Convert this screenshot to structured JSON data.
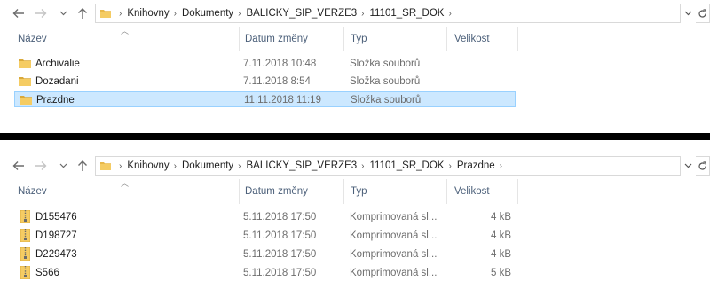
{
  "top": {
    "breadcrumb": [
      "Knihovny",
      "Dokumenty",
      "BALICKY_SIP_VERZE3",
      "11101_SR_DOK"
    ],
    "columns": {
      "name": "Název",
      "date": "Datum změny",
      "type": "Typ",
      "size": "Velikost"
    },
    "rows": [
      {
        "name": "Archivalie",
        "date": "7.11.2018 10:48",
        "type": "Složka souborů",
        "size": ""
      },
      {
        "name": "Dozadani",
        "date": "7.11.2018 8:54",
        "type": "Složka souborů",
        "size": ""
      },
      {
        "name": "Prazdne",
        "date": "11.11.2018 11:19",
        "type": "Složka souborů",
        "size": ""
      }
    ],
    "selected_row": "Prazdne"
  },
  "bottom": {
    "breadcrumb": [
      "Knihovny",
      "Dokumenty",
      "BALICKY_SIP_VERZE3",
      "11101_SR_DOK",
      "Prazdne"
    ],
    "columns": {
      "name": "Název",
      "date": "Datum změny",
      "type": "Typ",
      "size": "Velikost"
    },
    "rows": [
      {
        "name": "D155476",
        "date": "5.11.2018 17:50",
        "type": "Komprimovaná sl...",
        "size": "4 kB"
      },
      {
        "name": "D198727",
        "date": "5.11.2018 17:50",
        "type": "Komprimovaná sl...",
        "size": "4 kB"
      },
      {
        "name": "D229473",
        "date": "5.11.2018 17:50",
        "type": "Komprimovaná sl...",
        "size": "4 kB"
      },
      {
        "name": "S566",
        "date": "5.11.2018 17:50",
        "type": "Komprimovaná sl...",
        "size": "5 kB"
      }
    ]
  },
  "icons": {
    "back": "arrow-left-icon",
    "forward": "arrow-right-icon",
    "recent": "chevron-down-icon",
    "up": "arrow-up-icon",
    "folder": "folder-icon",
    "zip": "zip-folder-icon",
    "refresh": "refresh-icon",
    "sort": "sort-up-icon"
  },
  "colors": {
    "selection_bg": "#cce8ff",
    "selection_border": "#99d1ff",
    "header_text": "#4c607a",
    "folder": "#e8b84a"
  }
}
